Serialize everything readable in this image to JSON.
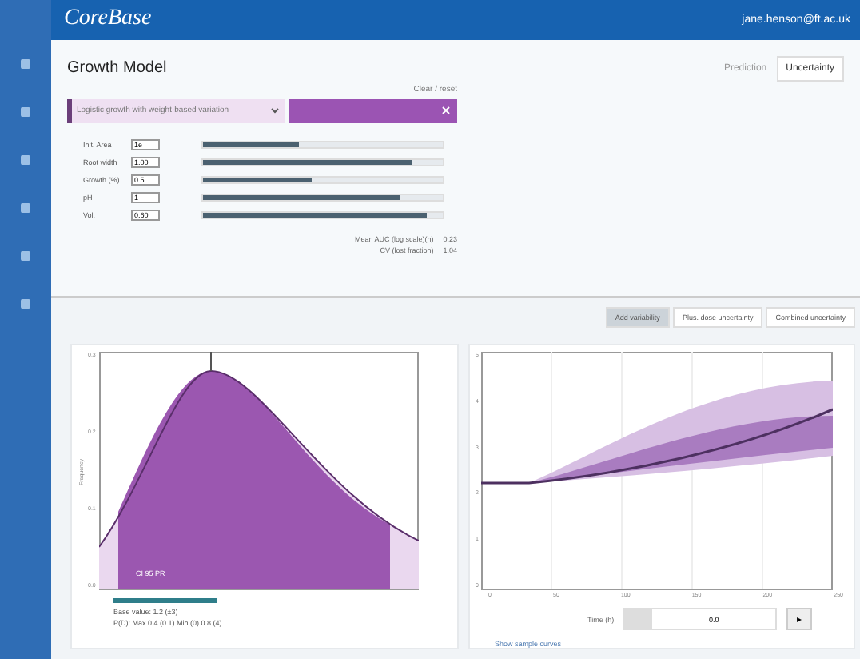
{
  "app": {
    "logo": "CoreBase",
    "user": "jane.henson@ft.ac.uk"
  },
  "page": {
    "title": "Growth Model",
    "tabs": [
      {
        "label": "Prediction",
        "selected": false
      },
      {
        "label": "Uncertainty",
        "selected": true
      }
    ]
  },
  "model": {
    "reset_link": "Clear / reset",
    "dropdown": "Logistic growth with weight-based variation",
    "sliders": [
      {
        "label": "Init. Area",
        "value": "1e",
        "level": 0.4
      },
      {
        "label": "Root width",
        "value": "1.00",
        "level": 0.87
      },
      {
        "label": "Growth (%)",
        "value": "0.5",
        "level": 0.45
      },
      {
        "label": "pH",
        "value": "1",
        "level": 0.82
      },
      {
        "label": "Vol.",
        "value": "0.60",
        "level": 0.93
      }
    ],
    "metrics": [
      {
        "label": "Mean AUC (log scale)(h)",
        "value": "0.23"
      },
      {
        "label": "CV (lost fraction)",
        "value": "1.04"
      }
    ]
  },
  "analysis_tabs": [
    {
      "label": "Add variability",
      "selected": true
    },
    {
      "label": "Plus. dose uncertainty",
      "selected": false
    },
    {
      "label": "Combined uncertainty",
      "selected": false
    }
  ],
  "distribution": {
    "ylabel": "Frequency",
    "yticks": [
      "0.3",
      "0.2",
      "0.1",
      "0.0"
    ],
    "band_label": "CI 95 PR",
    "base_value": "Base value: 1.2 (±3)",
    "interval": "P(D): Max 0.4 (0.1) Min (0) 0.8 (4)"
  },
  "trajectory": {
    "yticks": [
      "5",
      "4",
      "3",
      "2",
      "1",
      "0"
    ],
    "xticks": [
      "0",
      "50",
      "100",
      "150",
      "200",
      "250"
    ],
    "time_label": "Time (h)",
    "time_value": "0.0",
    "step_button": "▸",
    "link": "Show sample curves"
  }
}
